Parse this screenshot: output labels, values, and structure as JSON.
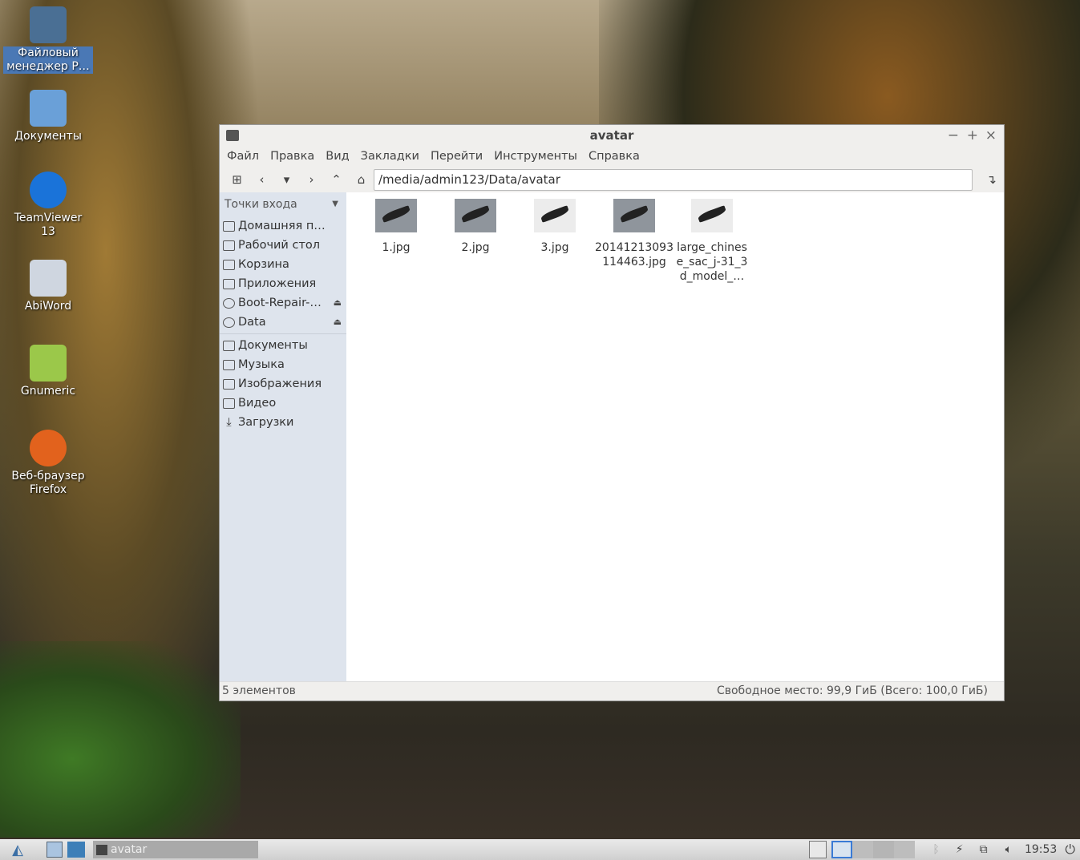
{
  "desktop": {
    "icons": [
      {
        "label": "Файловый менеджер P…",
        "color": "#4a6f94"
      },
      {
        "label": "Документы",
        "color": "#6aa0d8"
      },
      {
        "label": "TeamViewer 13",
        "color": "#1a73d9"
      },
      {
        "label": "AbiWord",
        "color": "#cfd6e0"
      },
      {
        "label": "Gnumeric",
        "color": "#9bc84a"
      },
      {
        "label": "Веб-браузер Firefox",
        "color": "#e2621d"
      }
    ]
  },
  "window": {
    "title": "avatar",
    "controls": [
      "−",
      "+",
      "×"
    ],
    "menu": [
      "Файл",
      "Правка",
      "Вид",
      "Закладки",
      "Перейти",
      "Инструменты",
      "Справка"
    ],
    "path": "/media/admin123/Data/avatar",
    "sidebar": {
      "header": "Точки входа",
      "places": [
        "Домашняя п…",
        "Рабочий стол",
        "Корзина",
        "Приложения",
        "Boot-Repair-…",
        "Data"
      ],
      "bookmarks": [
        "Документы",
        "Музыка",
        "Изображения",
        "Видео",
        "Загрузки"
      ]
    },
    "files": [
      "1.jpg",
      "2.jpg",
      "3.jpg",
      "20141213093 114463.jpg",
      "large_chines e_sac_j-31_3 d_model_…"
    ],
    "status_left": "5 элементов",
    "status_right": "Свободное место: 99,9 ГиБ (Всего: 100,0 ГиБ)"
  },
  "taskbar": {
    "task": "avatar",
    "clock": "19:53"
  }
}
